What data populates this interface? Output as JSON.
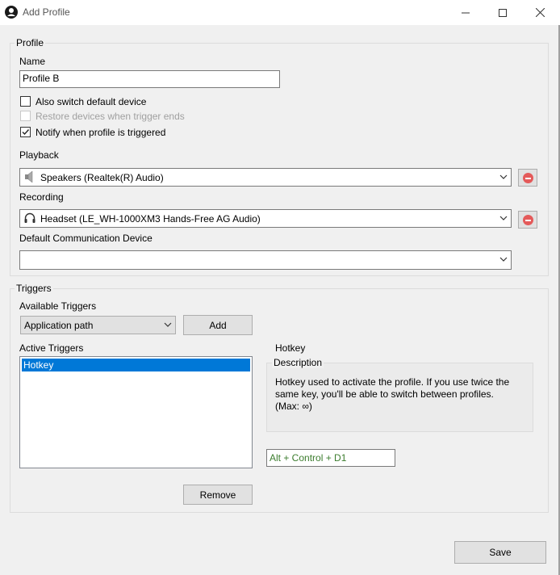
{
  "window": {
    "title": "Add Profile",
    "controls": {
      "minimize": "minimize",
      "maximize": "maximize",
      "close": "close"
    }
  },
  "profile": {
    "group_title": "Profile",
    "name_label": "Name",
    "name_value": "Profile B",
    "also_switch_label": "Also switch default device",
    "also_switch_checked": false,
    "restore_label": "Restore devices when trigger ends",
    "restore_enabled": false,
    "notify_label": "Notify when profile is triggered",
    "notify_checked": true,
    "playback_label": "Playback",
    "playback_device": "Speakers (Realtek(R) Audio)",
    "playback_icon": "speaker-icon",
    "recording_label": "Recording",
    "recording_device": "Headset (LE_WH-1000XM3 Hands-Free AG Audio)",
    "recording_icon": "headset-icon",
    "communication_label": "Default Communication Device",
    "communication_device": ""
  },
  "triggers": {
    "group_title": "Triggers",
    "available_label": "Available Triggers",
    "available_selected": "Application path",
    "add_label": "Add",
    "active_label": "Active Triggers",
    "active_items": [
      "Hotkey"
    ],
    "remove_label": "Remove",
    "detail_title": "Hotkey",
    "description_title": "Description",
    "description_text": "Hotkey used to activate the profile. If you use twice the same key, you'll be able to switch between profiles. (Max: ∞)",
    "hotkey_value": "Alt + Control + D1"
  },
  "footer": {
    "save_label": "Save"
  },
  "colors": {
    "selection": "#0078d7",
    "remove_red": "#e45a5a",
    "hotkey_text": "#3c7d2e"
  }
}
